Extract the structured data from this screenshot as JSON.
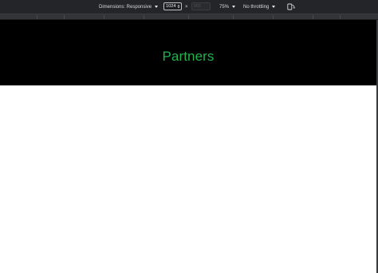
{
  "device_toolbar": {
    "dimensions_label": "Dimensions: Responsive",
    "width_value": "1024",
    "separator": "×",
    "height_value": "865",
    "zoom_label": "75%",
    "throttling_label": "No throttling",
    "rotate_icon": "rotate-device-icon"
  },
  "page": {
    "hero_title": "Partners",
    "hero_title_color": "#22b14c",
    "hero_background": "#000000",
    "body_background": "#ffffff"
  }
}
